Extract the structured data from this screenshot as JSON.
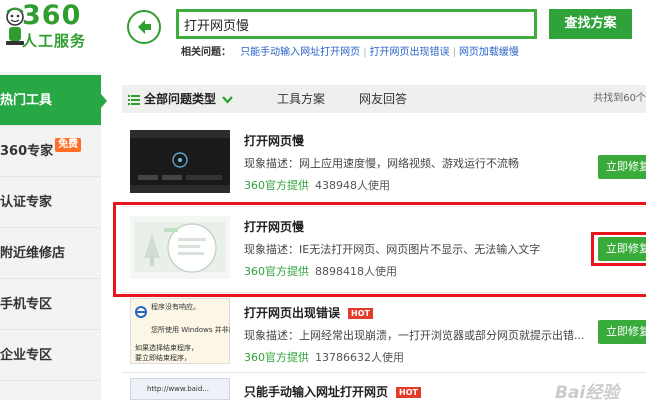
{
  "logo": {
    "number": "360",
    "subtitle": "人工服务"
  },
  "sidebar": {
    "items": [
      {
        "label": "热门工具",
        "active": true
      },
      {
        "label": "360专家",
        "badge": "免费"
      },
      {
        "label": "认证专家"
      },
      {
        "label": "附近维修店"
      },
      {
        "label": "手机专区"
      },
      {
        "label": "企业专区"
      }
    ]
  },
  "search": {
    "value": "打开网页慢",
    "button_label": "查找方案"
  },
  "related": {
    "label": "相关问题：",
    "links": [
      "只能手动输入网址打开网页",
      "打开网页出现错误",
      "网页加载缓慢"
    ]
  },
  "filter": {
    "all_label": "全部问题类型",
    "tabs": [
      "工具方案",
      "网友回答"
    ],
    "count_text": "共找到60个"
  },
  "results": [
    {
      "title": "打开网页慢",
      "hot": false,
      "desc": "现象描述：网上应用速度慢，网络视频、游戏运行不流畅",
      "provider": "360官方提供",
      "uses": "438948人使用",
      "button": "立即修复"
    },
    {
      "title": "打开网页慢",
      "hot": false,
      "desc": "现象描述：IE无法打开网页、网页图片不显示、无法输入文字",
      "provider": "360官方提供",
      "uses": "8898418人使用",
      "button": "立即修复"
    },
    {
      "title": "打开网页出现错误",
      "hot": true,
      "hot_label": "HOT",
      "desc": "现象描述：上网经常出现崩溃，一打开浏览器或部分网页就提示出错...",
      "provider": "360官方提供",
      "uses": "13786632人使用",
      "button": "立即修复"
    },
    {
      "title": "只能手动输入网址打开网页",
      "hot": true,
      "hot_label": "HOT"
    }
  ],
  "thumbs": {
    "t3_lines": [
      "程序没有响应。",
      "您所使用 Windows 并非原版",
      "如果选择结束程序，",
      "要立即结束程序，"
    ],
    "t4_text": "http://www.baid..."
  },
  "watermark": "Bai经验",
  "colors": {
    "brand_green": "#2fa33a",
    "highlight_red": "#e8141b",
    "hot_red": "#e23b2a",
    "badge_orange": "#ff6d28",
    "link_blue": "#2a64c8"
  }
}
